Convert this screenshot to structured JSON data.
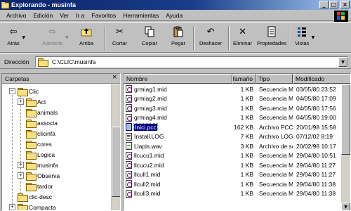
{
  "window": {
    "title": "Explorando - musinfa"
  },
  "menu": [
    "Archivo",
    "Edición",
    "Ver",
    "Ir a",
    "Favoritos",
    "Herramientas",
    "Ayuda"
  ],
  "toolbar": {
    "back": "Atrás",
    "forward": "Adelante",
    "up": "Arriba",
    "cut": "Cortar",
    "copy": "Copiar",
    "paste": "Pegar",
    "undo": "Deshacer",
    "delete": "Eliminar",
    "properties": "Propiedades",
    "views": "Vistas"
  },
  "address": {
    "label": "Dirección",
    "value": "C:\\CLIC\\musinfa"
  },
  "tree": {
    "header": "Carpetas",
    "items": [
      {
        "label": "Clic",
        "expander": "−"
      },
      {
        "label": "Act",
        "expander": "+"
      },
      {
        "label": "animals",
        "expander": ""
      },
      {
        "label": "associa",
        "expander": ""
      },
      {
        "label": "clicinfa",
        "expander": ""
      },
      {
        "label": "cores",
        "expander": ""
      },
      {
        "label": "Logica",
        "expander": ""
      },
      {
        "label": "musinfa",
        "expander": "+"
      },
      {
        "label": "Observa",
        "expander": "+"
      },
      {
        "label": "tardor",
        "expander": ""
      },
      {
        "label": "clic-desc",
        "expander": ""
      },
      {
        "label": "Compacta",
        "expander": "+"
      }
    ]
  },
  "columns": {
    "name": "Nombre",
    "size": "Tamaño",
    "type": "Tipo",
    "modified": "Modificado"
  },
  "files": [
    {
      "name": "grmiag1.mid",
      "size": "1 KB",
      "type": "Secuencia M...",
      "modified": "03/05/80 23:52",
      "icon": "midi-icon"
    },
    {
      "name": "grmiag2.mid",
      "size": "1 KB",
      "type": "Secuencia M...",
      "modified": "04/05/80 17:09",
      "icon": "midi-icon"
    },
    {
      "name": "grmiag3.mid",
      "size": "1 KB",
      "type": "Secuencia M...",
      "modified": "04/05/80 17:56",
      "icon": "midi-icon"
    },
    {
      "name": "grmiag4.mid",
      "size": "1 KB",
      "type": "Secuencia M...",
      "modified": "04/05/80 19:00",
      "icon": "midi-icon"
    },
    {
      "name": "Inici.pcc",
      "size": "162 KB",
      "type": "Archivo PCC",
      "modified": "20/01/98 15:58",
      "icon": "pcc-icon",
      "selected": true
    },
    {
      "name": "Install.LOG",
      "size": "7 KB",
      "type": "Archivo LOG",
      "modified": "07/12/02 8:19",
      "icon": "log-icon"
    },
    {
      "name": "Llapis.wav",
      "size": "3 KB",
      "type": "Archivo de so...",
      "modified": "20/02/98 10:17",
      "icon": "wav-icon"
    },
    {
      "name": "llcucu1.mid",
      "size": "1 KB",
      "type": "Secuencia M...",
      "modified": "29/04/80 10:51",
      "icon": "midi-icon"
    },
    {
      "name": "llcucu2.mid",
      "size": "1 KB",
      "type": "Secuencia M...",
      "modified": "29/04/80 11:27",
      "icon": "midi-icon"
    },
    {
      "name": "llcull1.mid",
      "size": "1 KB",
      "type": "Secuencia M...",
      "modified": "29/04/80 11:27",
      "icon": "midi-icon"
    },
    {
      "name": "llcull2.mid",
      "size": "1 KB",
      "type": "Secuencia M...",
      "modified": "29/04/80 11:38",
      "icon": "midi-icon"
    },
    {
      "name": "llcull3.mid",
      "size": "1 KB",
      "type": "Secuencia M...",
      "modified": "29/04/80 11:38",
      "icon": "midi-icon"
    }
  ]
}
